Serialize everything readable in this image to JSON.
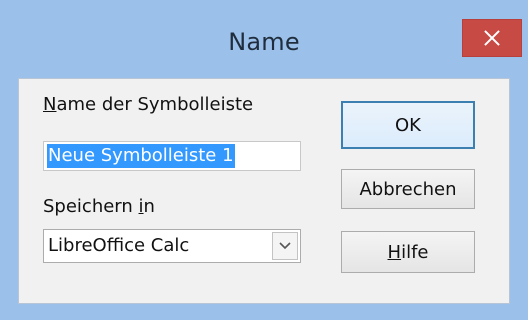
{
  "window": {
    "title": "Name"
  },
  "close_button": {
    "icon": "close-icon"
  },
  "name_field": {
    "label_mnemonic": "N",
    "label_rest": "ame der Symbolleiste",
    "value": "Neue Symbolleiste 1"
  },
  "save_in": {
    "label_pre": "Speichern ",
    "label_mnemonic": "i",
    "label_post": "n",
    "selected": "LibreOffice Calc",
    "arrow_icon": "chevron-down-icon"
  },
  "buttons": {
    "ok_label": "OK",
    "cancel_label": "Abbrechen",
    "help_mnemonic": "H",
    "help_rest": "ilfe"
  },
  "colors": {
    "frame": "#9bc1ea",
    "close_button": "#c84a45",
    "selection": "#3399ff",
    "default_button_border": "#3c7fb1"
  }
}
